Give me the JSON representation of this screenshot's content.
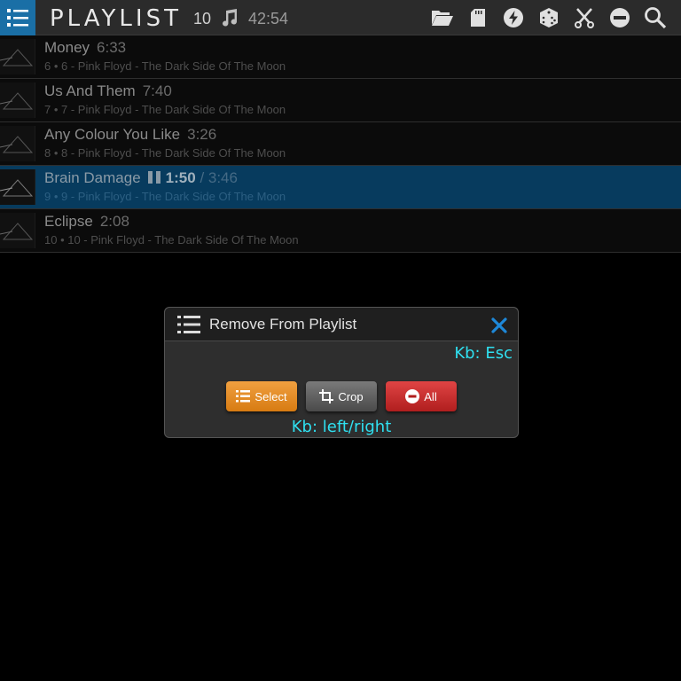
{
  "header": {
    "title": "PLAYLIST",
    "count": "10",
    "duration": "42:54",
    "accent": "#1a6fa6",
    "toolbar_icons": [
      "folder-open-icon",
      "sd-card-icon",
      "lightning-icon",
      "dice-icon",
      "scissors-icon",
      "minus-circle-icon",
      "search-icon"
    ]
  },
  "playlist": [
    {
      "title": "Money",
      "time": "6:33",
      "sub": "6 • 6 - Pink Floyd - The Dark Side Of The Moon"
    },
    {
      "title": "Us And Them",
      "time": "7:40",
      "sub": "7 • 7 - Pink Floyd - The Dark Side Of The Moon"
    },
    {
      "title": "Any Colour You Like",
      "time": "3:26",
      "sub": "8 • 8 - Pink Floyd - The Dark Side Of The Moon"
    },
    {
      "title": "Brain Damage",
      "elapsed": "1:50",
      "total": "/ 3:46",
      "sub": "9 • 9 - Pink Floyd - The Dark Side Of The Moon"
    },
    {
      "title": "Eclipse",
      "time": "2:08",
      "sub": "10 • 10 - Pink Floyd - The Dark Side Of The Moon"
    }
  ],
  "dialog": {
    "title": "Remove From Playlist",
    "kb_close": "Kb:  Esc",
    "kb_nav": "Kb:  left/right",
    "buttons": {
      "select": "Select",
      "crop": "Crop",
      "all": "All"
    }
  }
}
